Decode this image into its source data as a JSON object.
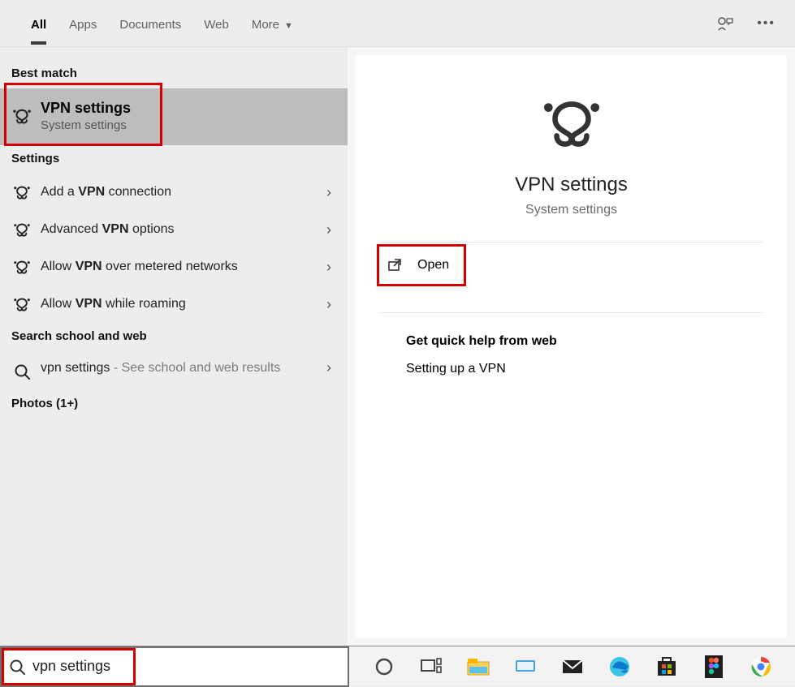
{
  "tabs": {
    "all": "All",
    "apps": "Apps",
    "documents": "Documents",
    "web": "Web",
    "more": "More"
  },
  "sections": {
    "best_match": "Best match",
    "settings": "Settings",
    "search_web": "Search school and web",
    "photos": "Photos (1+)"
  },
  "best_match": {
    "title": "VPN settings",
    "subtitle": "System settings"
  },
  "settings_items": [
    {
      "pre": "Add a ",
      "bold": "VPN",
      "post": " connection"
    },
    {
      "pre": "Advanced ",
      "bold": "VPN",
      "post": " options"
    },
    {
      "pre": "Allow ",
      "bold": "VPN",
      "post": " over metered networks"
    },
    {
      "pre": "Allow ",
      "bold": "VPN",
      "post": " while roaming"
    }
  ],
  "web_item": {
    "query": "vpn settings",
    "suffix": " - See school and web results"
  },
  "preview": {
    "title": "VPN settings",
    "subtitle": "System settings",
    "open": "Open",
    "quick_help_header": "Get quick help from web",
    "quick_help_link": "Setting up a VPN"
  },
  "search": {
    "value": "vpn settings"
  },
  "taskbar_icons": [
    "cortana",
    "taskview",
    "explorer",
    "word",
    "mail",
    "edge",
    "store",
    "figma",
    "chrome"
  ]
}
